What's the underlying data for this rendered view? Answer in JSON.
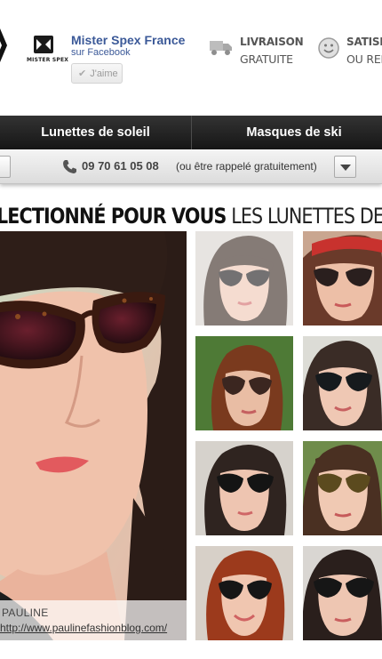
{
  "header": {
    "facebook": {
      "page_name": "Mister Spex France",
      "subtitle": "sur Facebook",
      "like_label": "J'aime"
    },
    "logo_text": "MISTER SPEX",
    "usps": [
      {
        "title": "LIVRAISON",
        "subtitle": "GRATUITE",
        "icon": "truck-icon"
      },
      {
        "title": "SATISFA",
        "subtitle": "OU REM",
        "icon": "smiley-icon"
      }
    ]
  },
  "nav": {
    "items": [
      {
        "label": "Lunettes de soleil"
      },
      {
        "label": "Masques de ski"
      }
    ]
  },
  "phone_bar": {
    "number": "09 70 61 05 08",
    "note": "(ou être rappelé gratuitement)",
    "icon": "phone-icon"
  },
  "section": {
    "heading_strong": "LECTIONNÉ POUR VOUS",
    "heading_light": "LES LUNETTES DE"
  },
  "feature": {
    "caption_name": "PAULINE",
    "caption_link": "http://www.paulinefashionblog.com/"
  },
  "colors": {
    "facebook_blue": "#3b5998",
    "nav_dark": "#1f1f1f",
    "text_gray": "#555555"
  }
}
